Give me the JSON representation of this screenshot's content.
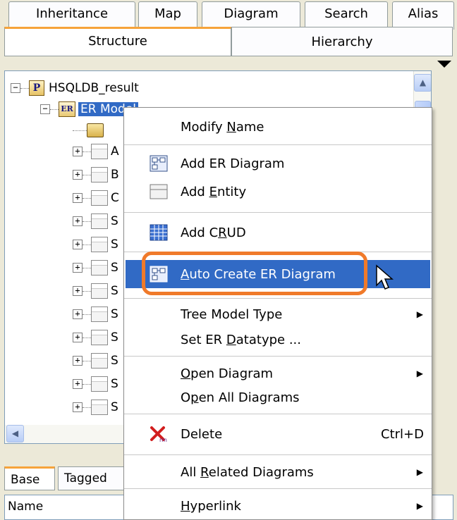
{
  "top_tabs": [
    "Inheritance",
    "Map",
    "Diagram",
    "Search",
    "Alias"
  ],
  "view_tabs": {
    "structure": "Structure",
    "hierarchy": "Hierarchy"
  },
  "tree": {
    "root": "HSQLDB_result",
    "model": "ER Model",
    "entity_prefixes": [
      "A",
      "B",
      "C",
      "S",
      "S",
      "S",
      "S",
      "S",
      "S",
      "S",
      "S",
      "S"
    ]
  },
  "bottom_panel": {
    "tabs": [
      "Base",
      "Tagged"
    ],
    "grid_header": "Name"
  },
  "context_menu": {
    "items": [
      {
        "label_pre": "Modify ",
        "label_u": "N",
        "label_post": "ame",
        "icon": "none"
      },
      {
        "label_pre": "Add ER Diagram",
        "label_u": "",
        "label_post": "",
        "icon": "er-diagram-icon"
      },
      {
        "label_pre": "Add ",
        "label_u": "E",
        "label_post": "ntity",
        "icon": "entity-icon"
      },
      {
        "label_pre": "Add C",
        "label_u": "R",
        "label_post": "UD",
        "icon": "crud-icon"
      },
      {
        "label_pre": "",
        "label_u": "A",
        "label_post": "uto Create ER Diagram",
        "icon": "er-diagram-icon"
      },
      {
        "label_pre": "Tree Model Type",
        "label_u": "",
        "label_post": "",
        "icon": "none"
      },
      {
        "label_pre": "Set ER ",
        "label_u": "D",
        "label_post": "atatype ...",
        "icon": "none"
      },
      {
        "label_pre": "",
        "label_u": "O",
        "label_post": "pen Diagram",
        "icon": "none"
      },
      {
        "label_pre": "O",
        "label_u": "p",
        "label_post": "en All Diagrams",
        "icon": "none"
      },
      {
        "label_pre": "Delete",
        "label_u": "",
        "label_post": "",
        "icon": "delete-icon"
      },
      {
        "label_pre": "All ",
        "label_u": "R",
        "label_post": "elated Diagrams",
        "icon": "none"
      },
      {
        "label_pre": "",
        "label_u": "H",
        "label_post": "yperlink",
        "icon": "none"
      }
    ],
    "delete_shortcut": "Ctrl+D",
    "highlighted_item": "Auto Create ER Diagram",
    "highlight_color": "#316ac5",
    "callout_color": "#f07a2a"
  }
}
